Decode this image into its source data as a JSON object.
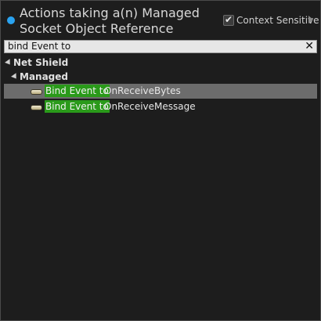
{
  "header": {
    "title": "Actions taking a(n) Managed Socket Object Reference",
    "context_sensitive_label": "Context Sensitive",
    "context_sensitive_checked": true
  },
  "search": {
    "value": "bind Event to"
  },
  "tree": {
    "category": "Net Shield",
    "subcategory": "Managed",
    "items": [
      {
        "highlight": "Bind Event to",
        "rest": "OnReceiveBytes",
        "selected": true
      },
      {
        "highlight": "Bind Event to",
        "rest": "OnReceiveMessage",
        "selected": false
      }
    ]
  },
  "colors": {
    "status_dot": "#2aa3f0",
    "highlight": "#2a9a1a",
    "selected_row": "#6c6c6c"
  },
  "icons": [
    "status-dot-icon",
    "checkmark-icon",
    "expand-arrow-icon",
    "clear-icon",
    "collapse-triangle-icon",
    "event-pin-icon"
  ]
}
